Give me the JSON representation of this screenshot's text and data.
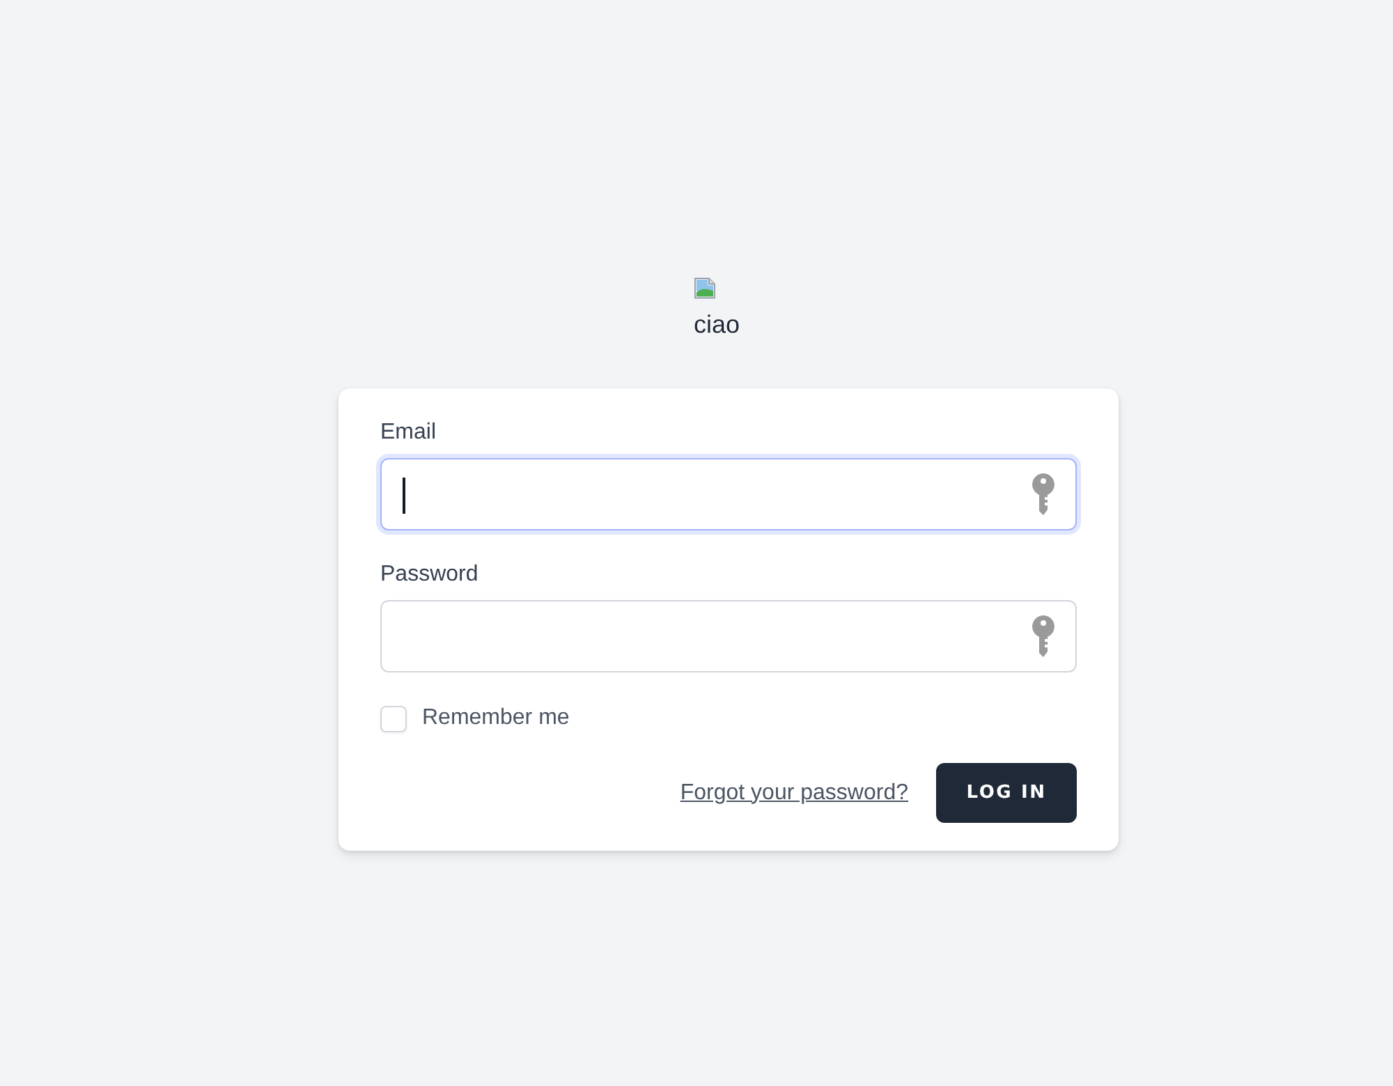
{
  "logo": {
    "alt_text": "ciao"
  },
  "form": {
    "fields": [
      {
        "label": "Email",
        "focused": true
      },
      {
        "label": "Password",
        "focused": false
      }
    ],
    "remember": {
      "label": "Remember me",
      "checked": false
    },
    "forgot_link": "Forgot your password?",
    "submit_button": "LOG IN"
  }
}
